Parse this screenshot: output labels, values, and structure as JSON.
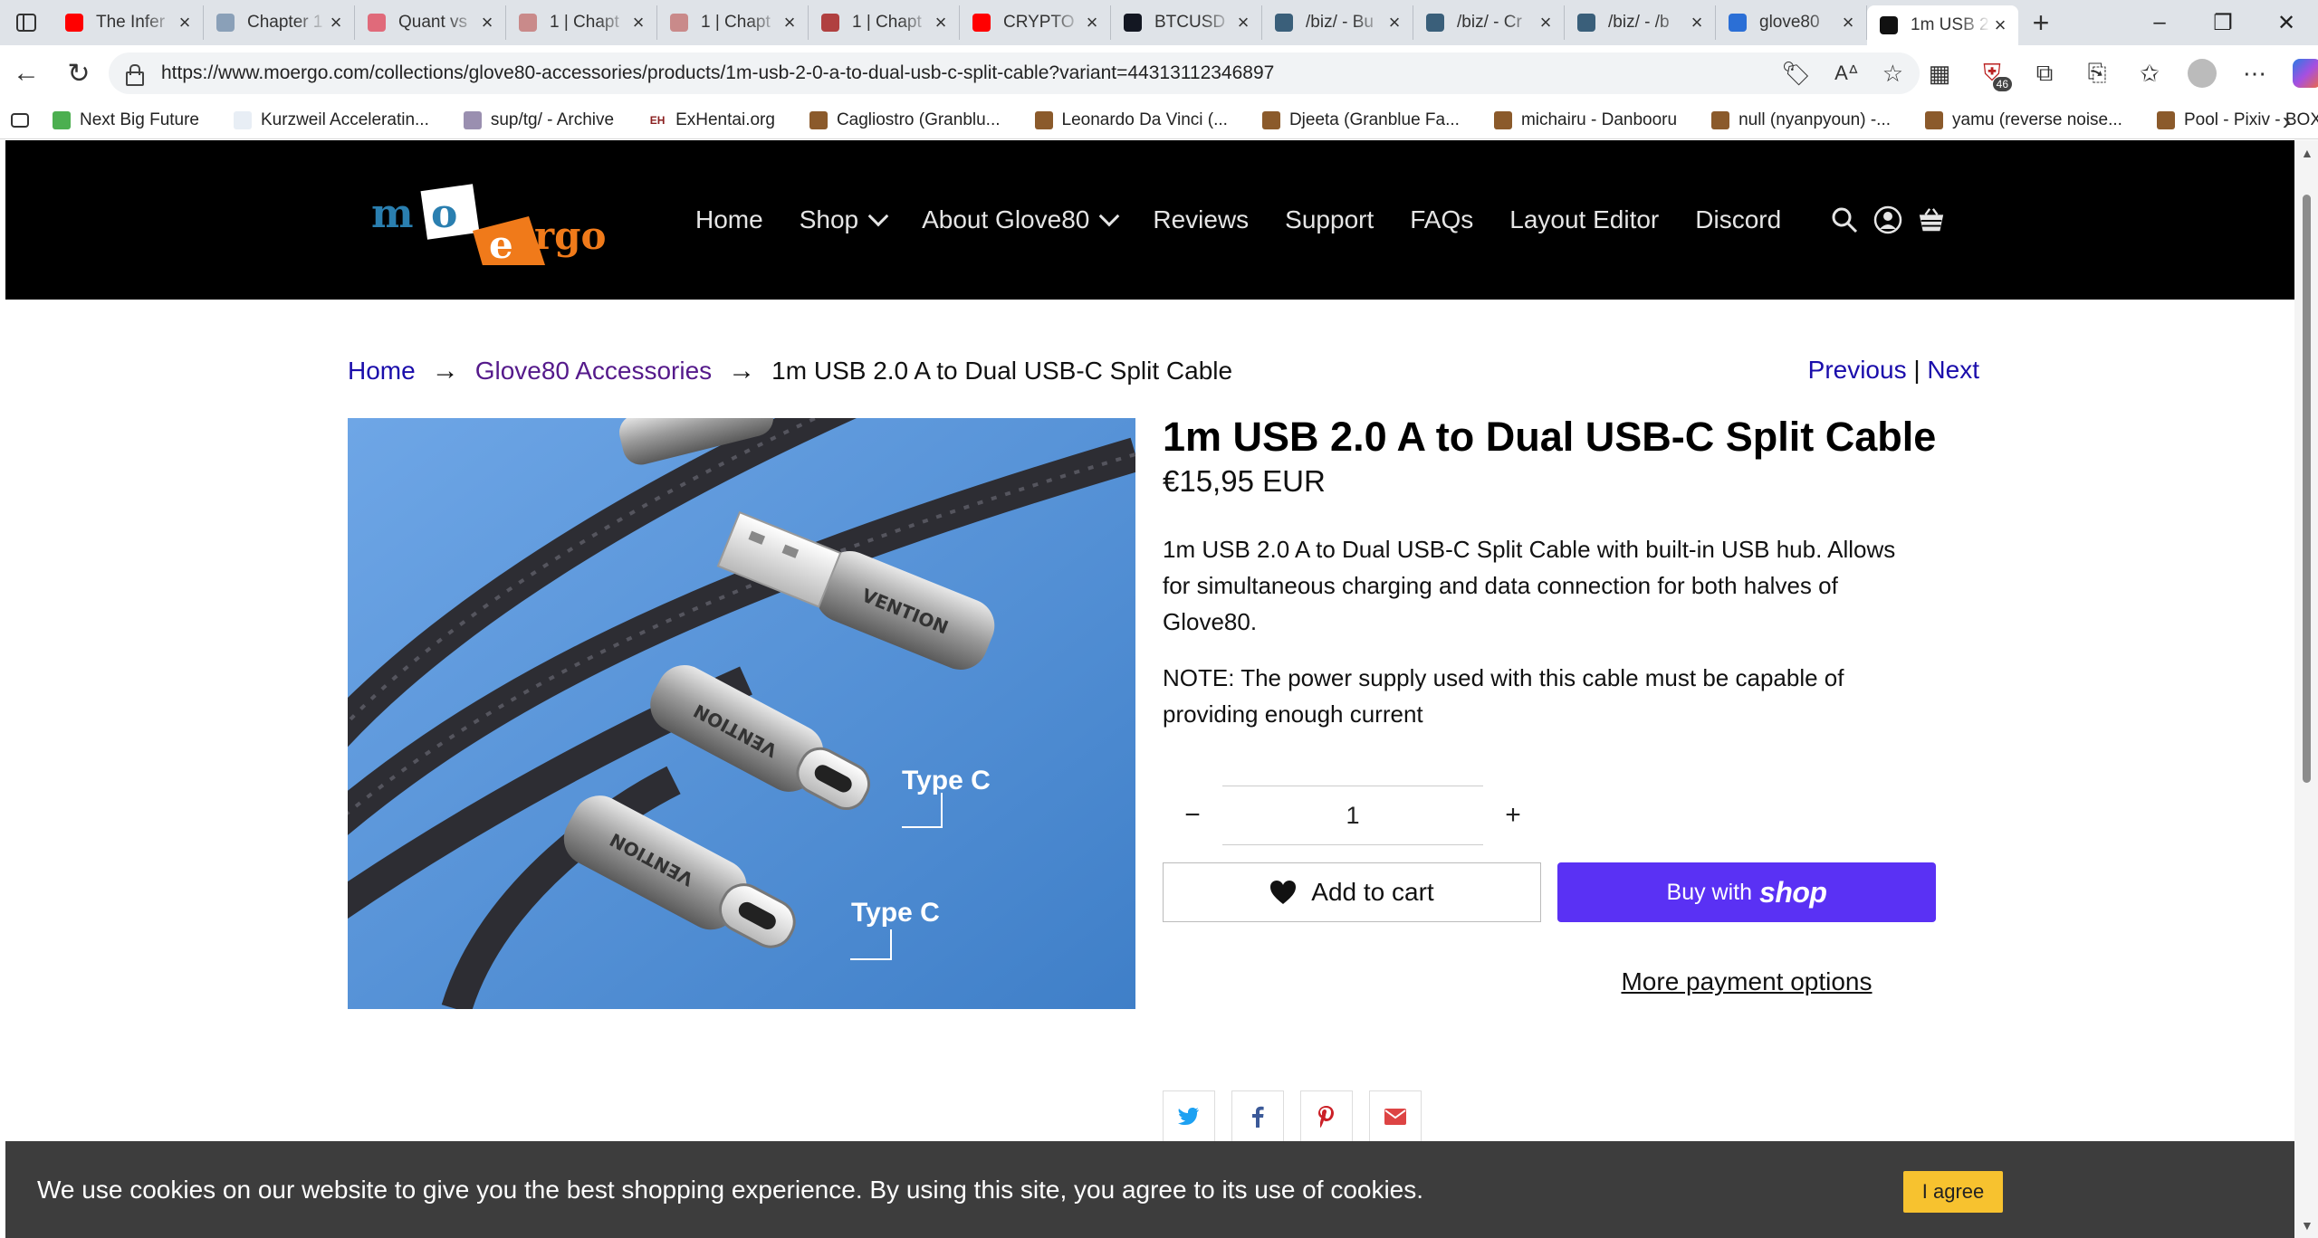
{
  "browser": {
    "tabs": [
      {
        "title": "The Infer",
        "favicon_color": "#ff0000",
        "favicon": "youtube-icon"
      },
      {
        "title": "Chapter 1",
        "favicon_color": "#8aa0b8",
        "favicon": "wordpress-icon"
      },
      {
        "title": "Quant vs",
        "favicon_color": "#e06a7a",
        "favicon": "youtube-icon"
      },
      {
        "title": "1 | Chapt",
        "favicon_color": "#c98a8a",
        "favicon": "avatar-icon"
      },
      {
        "title": "1 | Chapt",
        "favicon_color": "#c98a8a",
        "favicon": "avatar-icon"
      },
      {
        "title": "1 | Chapt",
        "favicon_color": "#b04040",
        "favicon": "avatar-icon"
      },
      {
        "title": "CRYPTO",
        "favicon_color": "#ff0000",
        "favicon": "youtube-icon"
      },
      {
        "title": "BTCUSD",
        "favicon_color": "#131722",
        "favicon": "tradingview-icon"
      },
      {
        "title": "/biz/ - Bu",
        "favicon_color": "#3a5f7a",
        "favicon": "clover-icon"
      },
      {
        "title": "/biz/ - Cr",
        "favicon_color": "#3a5f7a",
        "favicon": "clover-icon"
      },
      {
        "title": "/biz/ - /b",
        "favicon_color": "#3a5f7a",
        "favicon": "clover-icon"
      },
      {
        "title": "glove80",
        "favicon_color": "#2b6fd6",
        "favicon": "search-icon"
      },
      {
        "title": "1m USB 2",
        "favicon_color": "#111111",
        "favicon": "moergo-icon",
        "active": true
      }
    ],
    "url": "https://www.moergo.com/collections/glove80-accessories/products/1m-usb-2-0-a-to-dual-usb-c-split-cable?variant=44313112346897",
    "extension_badge": "46",
    "bookmarks": [
      {
        "label": "Next Big Future",
        "icon_color": "#4caf50"
      },
      {
        "label": "Kurzweil Acceleratin...",
        "icon_color": "#e8eef5"
      },
      {
        "label": "sup/tg/ - Archive",
        "icon_color": "#9a8fb0"
      },
      {
        "label": "ExHentai.org",
        "icon_color": "#8a1f1f",
        "icon_text": "EH"
      },
      {
        "label": "Cagliostro (Granblu...",
        "icon_color": "#8b5a2b"
      },
      {
        "label": "Leonardo Da Vinci (...",
        "icon_color": "#8b5a2b"
      },
      {
        "label": "Djeeta (Granblue Fa...",
        "icon_color": "#8b5a2b"
      },
      {
        "label": "michairu - Danbooru",
        "icon_color": "#8b5a2b"
      },
      {
        "label": "null (nyanpyoun) -...",
        "icon_color": "#8b5a2b"
      },
      {
        "label": "yamu (reverse noise...",
        "icon_color": "#8b5a2b"
      },
      {
        "label": "Pool - Pixiv - BOX S...",
        "icon_color": "#8b5a2b"
      }
    ]
  },
  "site": {
    "nav": {
      "home": "Home",
      "shop": "Shop",
      "about": "About Glove80",
      "reviews": "Reviews",
      "support": "Support",
      "faqs": "FAQs",
      "layout_editor": "Layout Editor",
      "discord": "Discord"
    },
    "breadcrumb": {
      "home": "Home",
      "collection": "Glove80 Accessories",
      "current": "1m USB 2.0 A to Dual USB-C Split Cable"
    },
    "pager": {
      "previous": "Previous",
      "separator": "|",
      "next": "Next"
    },
    "product": {
      "title": "1m USB 2.0 A to Dual USB-C Split Cable",
      "price": "€15,95 EUR",
      "description": "1m USB 2.0 A to Dual USB-C Split Cable with built-in USB hub. Allows for simultaneous charging and data connection for both halves of Glove80.",
      "note": "NOTE: The power supply used with this cable must be capable of providing enough current",
      "image_labels": {
        "type_c_1": "Type C",
        "type_c_2": "Type C",
        "brand": "VENTION"
      },
      "quantity": "1",
      "add_to_cart": "Add to cart",
      "buy_with": "Buy with",
      "buy_with_brand": "shop",
      "more_payment": "More payment options"
    },
    "cookie": {
      "text": "We use cookies on our website to give you the best shopping experience. By using this site, you agree to its use of cookies.",
      "agree": "I agree"
    },
    "colors": {
      "header_bg": "#000000",
      "shop_pay": "#5a31f4",
      "cookie_bg": "#3d3d3d",
      "agree_btn": "#f7c22f",
      "logo_blue": "#2a7fb0",
      "logo_orange": "#f07a1a"
    }
  }
}
